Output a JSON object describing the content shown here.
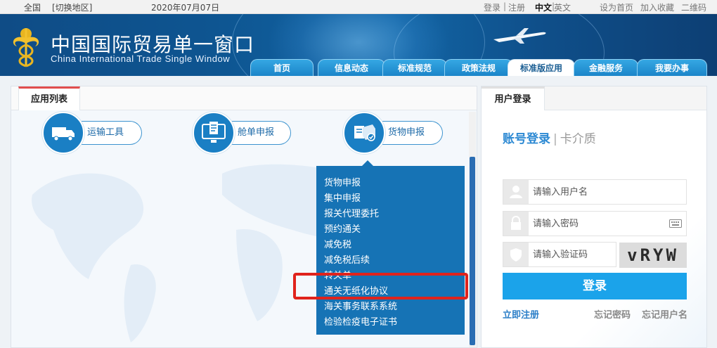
{
  "topbar": {
    "region": "全国",
    "switch_region": "[切换地区]",
    "date": "2020年07月07日",
    "login": "登录",
    "divider": "|",
    "register": "注册",
    "lang_cn": "中文",
    "lang_en": "英文",
    "set_home": "设为首页",
    "add_favorite": "加入收藏",
    "qrcode": "二维码"
  },
  "header": {
    "title_cn": "中国国际贸易单一窗口",
    "title_en": "China International Trade Single  Window"
  },
  "nav": {
    "tabs": [
      "首页",
      "信息动态",
      "标准规范",
      "政策法规",
      "标准版应用",
      "金融服务",
      "我要办事"
    ],
    "active_index": 4
  },
  "app_list": {
    "title": "应用列表",
    "apps": [
      {
        "label": "运输工具",
        "icon": "truck-icon"
      },
      {
        "label": "舱单申报",
        "icon": "monitor-document-icon"
      },
      {
        "label": "货物申报",
        "icon": "cargo-box-icon"
      }
    ],
    "dropdown_items": [
      "货物申报",
      "集中申报",
      "报关代理委托",
      "预约通关",
      "减免税",
      "减免税后续",
      "转关单",
      "通关无纸化协议",
      "海关事务联系系统",
      "检验检疫电子证书"
    ],
    "highlighted_item": "通关无纸化协议"
  },
  "login": {
    "title": "用户登录",
    "tab_account": "账号登录",
    "tab_divider": "|",
    "tab_card": "卡介质",
    "username_placeholder": "请输入用户名",
    "password_placeholder": "请输入密码",
    "captcha_placeholder": "请输入验证码",
    "captcha_text": "vRYW",
    "submit": "登录",
    "register": "立即注册",
    "forgot_password": "忘记密码",
    "forgot_username": "忘记用户名"
  },
  "colors": {
    "brand_blue": "#1673b5",
    "header_blue": "#0f4c86",
    "login_button": "#1ba3ea",
    "highlight_red": "#e0231c"
  }
}
